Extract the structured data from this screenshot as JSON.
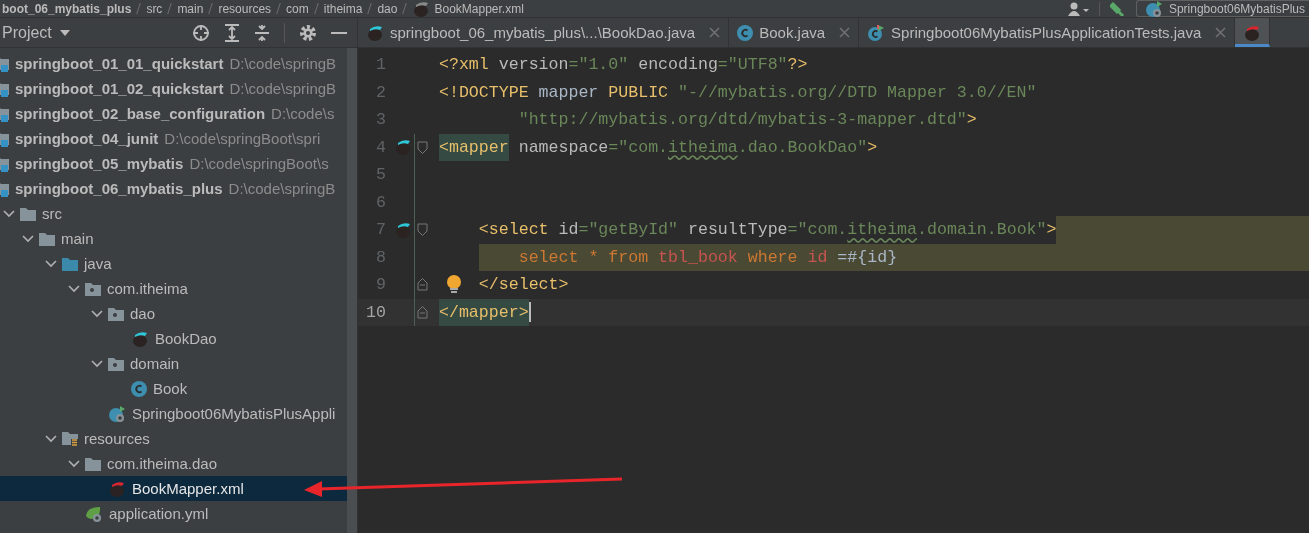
{
  "breadcrumbs": {
    "items": [
      {
        "label": "boot_06_mybatis_plus",
        "kind": "module"
      },
      {
        "label": "src",
        "kind": "folder"
      },
      {
        "label": "main",
        "kind": "folder"
      },
      {
        "label": "resources",
        "kind": "folder"
      },
      {
        "label": "com",
        "kind": "folder"
      },
      {
        "label": "itheima",
        "kind": "folder"
      },
      {
        "label": "dao",
        "kind": "folder"
      },
      {
        "label": "BookMapper.xml",
        "kind": "mapper-file"
      }
    ],
    "run_config": "Springboot06MybatisPlus"
  },
  "project_panel": {
    "title": "Project"
  },
  "tree": [
    {
      "label": "springboot_01_01_quickstart",
      "path": "D:\\code\\springB",
      "kind": "module",
      "selected": false
    },
    {
      "label": "springboot_01_02_quickstart",
      "path": "D:\\code\\springB",
      "kind": "module",
      "selected": false
    },
    {
      "label": "springboot_02_base_configuration",
      "path": "D:\\code\\s",
      "kind": "module",
      "selected": false
    },
    {
      "label": "springboot_04_junit",
      "path": "D:\\code\\springBoot\\spri",
      "kind": "module",
      "selected": false
    },
    {
      "label": "springboot_05_mybatis",
      "path": "D:\\code\\springBoot\\s",
      "kind": "module",
      "selected": false
    },
    {
      "label": "springboot_06_mybatis_plus",
      "path": "D:\\code\\springB",
      "kind": "module",
      "selected": false,
      "children": [
        {
          "label": "src",
          "kind": "folder",
          "expanded": true,
          "selected": false,
          "children": [
            {
              "label": "main",
              "kind": "folder",
              "expanded": true,
              "selected": false,
              "children": [
                {
                  "label": "java",
                  "kind": "source-folder",
                  "expanded": true,
                  "selected": false,
                  "children": [
                    {
                      "label": "com.itheima",
                      "kind": "package",
                      "expanded": true,
                      "selected": false,
                      "children": [
                        {
                          "label": "dao",
                          "kind": "package",
                          "expanded": true,
                          "selected": false,
                          "children": [
                            {
                              "label": "BookDao",
                              "kind": "mybatis-file",
                              "selected": false
                            }
                          ]
                        },
                        {
                          "label": "domain",
                          "kind": "package",
                          "expanded": true,
                          "selected": false,
                          "children": [
                            {
                              "label": "Book",
                              "kind": "class",
                              "selected": false
                            }
                          ]
                        },
                        {
                          "label": "Springboot06MybatisPlusAppli",
                          "kind": "spring-class",
                          "selected": false
                        }
                      ]
                    }
                  ]
                },
                {
                  "label": "resources",
                  "kind": "resources-folder",
                  "expanded": true,
                  "selected": false,
                  "children": [
                    {
                      "label": "com.itheima.dao",
                      "kind": "folder",
                      "expanded": true,
                      "selected": false,
                      "children": [
                        {
                          "label": "BookMapper.xml",
                          "kind": "mybatis-xml",
                          "selected": true
                        }
                      ]
                    },
                    {
                      "label": "application.yml",
                      "kind": "spring-config",
                      "selected": false
                    }
                  ]
                }
              ]
            }
          ]
        }
      ]
    }
  ],
  "tabs": [
    {
      "label": "springboot_06_mybatis_plus\\...\\BookDao.java",
      "kind": "mybatis-file",
      "selected": false
    },
    {
      "label": "Book.java",
      "kind": "class",
      "selected": false
    },
    {
      "label": "Springboot06MybatisPlusApplicationTests.java",
      "kind": "test-class",
      "selected": false
    },
    {
      "kind": "mybatis-xml",
      "selected": true
    }
  ],
  "editor": {
    "lines": [
      {
        "number": "1",
        "kind": "xml",
        "current": false,
        "tokens": [
          {
            "text": "<?xml",
            "kind": "tag"
          },
          {
            "text": " version",
            "kind": "attr"
          },
          {
            "text": "=\"1.0\"",
            "kind": "string"
          },
          {
            "text": " encoding",
            "kind": "attr"
          },
          {
            "text": "=\"UTF8\"",
            "kind": "string"
          },
          {
            "text": "?>",
            "kind": "tag"
          }
        ]
      },
      {
        "number": "2",
        "kind": "xml",
        "current": false,
        "tokens": [
          {
            "text": "<!DOCTYPE",
            "kind": "tag"
          },
          {
            "text": " mapper ",
            "kind": "plain"
          },
          {
            "text": "PUBLIC",
            "kind": "tag"
          },
          {
            "text": " \"-//mybatis.org//DTD Mapper 3.0//EN\"",
            "kind": "string"
          }
        ]
      },
      {
        "number": "3",
        "kind": "xml",
        "current": false,
        "tokens": [
          {
            "text": "        \"http://mybatis.org/dtd/mybatis-3-mapper.dtd\"",
            "kind": "string"
          },
          {
            "text": ">",
            "kind": "tag"
          }
        ]
      },
      {
        "number": "4",
        "kind": "xml",
        "current": false,
        "mybatis_marker": true,
        "fold_start": true,
        "tokens": [
          {
            "text": "<mapper",
            "kind": "tag-match"
          },
          {
            "text": " namespace",
            "kind": "attr"
          },
          {
            "text": "=\"com.",
            "kind": "string"
          },
          {
            "text": "itheima",
            "kind": "string-typo"
          },
          {
            "text": ".dao.BookDao\"",
            "kind": "string"
          },
          {
            "text": ">",
            "kind": "tag"
          }
        ]
      },
      {
        "number": "5",
        "kind": "blank",
        "current": false
      },
      {
        "number": "6",
        "kind": "blank",
        "current": false
      },
      {
        "number": "7",
        "kind": "sql-start",
        "current": false,
        "mybatis_marker": true,
        "fold_start": true,
        "tokens": [
          {
            "text": "    <select",
            "kind": "tag"
          },
          {
            "text": " id",
            "kind": "attr"
          },
          {
            "text": "=\"getById\"",
            "kind": "string"
          },
          {
            "text": " resultType",
            "kind": "attr"
          },
          {
            "text": "=\"com.",
            "kind": "string"
          },
          {
            "text": "itheima",
            "kind": "string-typo"
          },
          {
            "text": ".domain.Book\"",
            "kind": "string"
          },
          {
            "text": ">",
            "kind": "tag"
          }
        ]
      },
      {
        "number": "8",
        "kind": "sql-body",
        "current": false,
        "tokens": [
          {
            "text": "    select * from ",
            "kind": "keyword"
          },
          {
            "text": "tbl_book",
            "kind": "identifier"
          },
          {
            "text": " where ",
            "kind": "keyword"
          },
          {
            "text": "id",
            "kind": "identifier"
          },
          {
            "text": " =#{id}",
            "kind": "plain"
          }
        ]
      },
      {
        "number": "9",
        "kind": "xml",
        "current": false,
        "fold_end": true,
        "bulb": true,
        "tokens": [
          {
            "text": "    </select>",
            "kind": "tag"
          }
        ]
      },
      {
        "number": "10",
        "kind": "xml",
        "current": true,
        "fold_end": true,
        "tokens": [
          {
            "text": "</mapper>",
            "kind": "tag-match"
          }
        ]
      }
    ]
  }
}
